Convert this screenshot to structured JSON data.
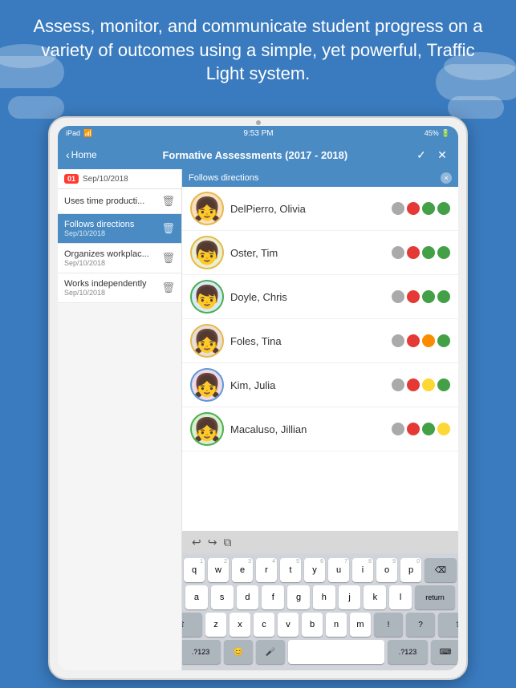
{
  "hero": {
    "text": "Assess, monitor, and communicate student progress on a variety of outcomes using a simple, yet powerful, Traffic Light system."
  },
  "statusBar": {
    "device": "iPad",
    "wifi": "WiFi",
    "time": "9:53 PM",
    "battery": "45%"
  },
  "navBar": {
    "backLabel": "Home",
    "title": "Formative Assessments (2017 - 2018)",
    "checkIcon": "✓",
    "closeIcon": "✕"
  },
  "sidebar": {
    "dateLabel": "Sep/10/2018",
    "dateBadge": "01",
    "items": [
      {
        "name": "Uses time producti...",
        "date": "",
        "active": false
      },
      {
        "name": "Follows directions",
        "date": "Sep/10/2018",
        "active": true
      },
      {
        "name": "Organizes workplac...",
        "date": "Sep/10/2018",
        "active": false
      },
      {
        "name": "Works independently",
        "date": "Sep/10/2018",
        "active": false
      }
    ]
  },
  "searchBar": {
    "label": "Follows directions",
    "clearBtn": "×"
  },
  "students": [
    {
      "name": "DelPierro, Olivia",
      "lights": [
        "gray",
        "red",
        "green",
        "green"
      ],
      "avatarEmoji": "👧",
      "borderColor": "border-yellow"
    },
    {
      "name": "Oster, Tim",
      "lights": [
        "gray",
        "red",
        "green",
        "green"
      ],
      "avatarEmoji": "👦",
      "borderColor": "border-yellow"
    },
    {
      "name": "Doyle, Chris",
      "lights": [
        "gray",
        "red",
        "green",
        "green"
      ],
      "avatarEmoji": "👦",
      "borderColor": "border-green"
    },
    {
      "name": "Foles, Tina",
      "lights": [
        "gray",
        "red",
        "orange",
        "green"
      ],
      "avatarEmoji": "👧",
      "borderColor": "border-yellow"
    },
    {
      "name": "Kim, Julia",
      "lights": [
        "gray",
        "red",
        "yellow",
        "green"
      ],
      "avatarEmoji": "👧",
      "borderColor": "border-blue"
    },
    {
      "name": "Macaluso, Jillian",
      "lights": [
        "gray",
        "red",
        "green",
        "yellow"
      ],
      "avatarEmoji": "👧",
      "borderColor": "border-green"
    }
  ],
  "toolbar": {
    "undoIcon": "↩",
    "redoIcon": "↪",
    "copyIcon": "⧉"
  },
  "keyboard": {
    "rows": [
      [
        "q",
        "w",
        "e",
        "r",
        "t",
        "y",
        "u",
        "i",
        "o",
        "p"
      ],
      [
        "a",
        "s",
        "d",
        "f",
        "g",
        "h",
        "j",
        "k",
        "l"
      ],
      [
        "z",
        "x",
        "c",
        "v",
        "b",
        "n",
        "m"
      ],
      [
        ".?123",
        "😊",
        "🎤",
        "",
        "",
        ".?123",
        "⌨"
      ]
    ],
    "subNumbers": {
      "q": "1",
      "w": "2",
      "e": "3",
      "r": "4",
      "t": "5",
      "y": "6",
      "u": "7",
      "i": "8",
      "o": "9",
      "p": "0"
    }
  }
}
